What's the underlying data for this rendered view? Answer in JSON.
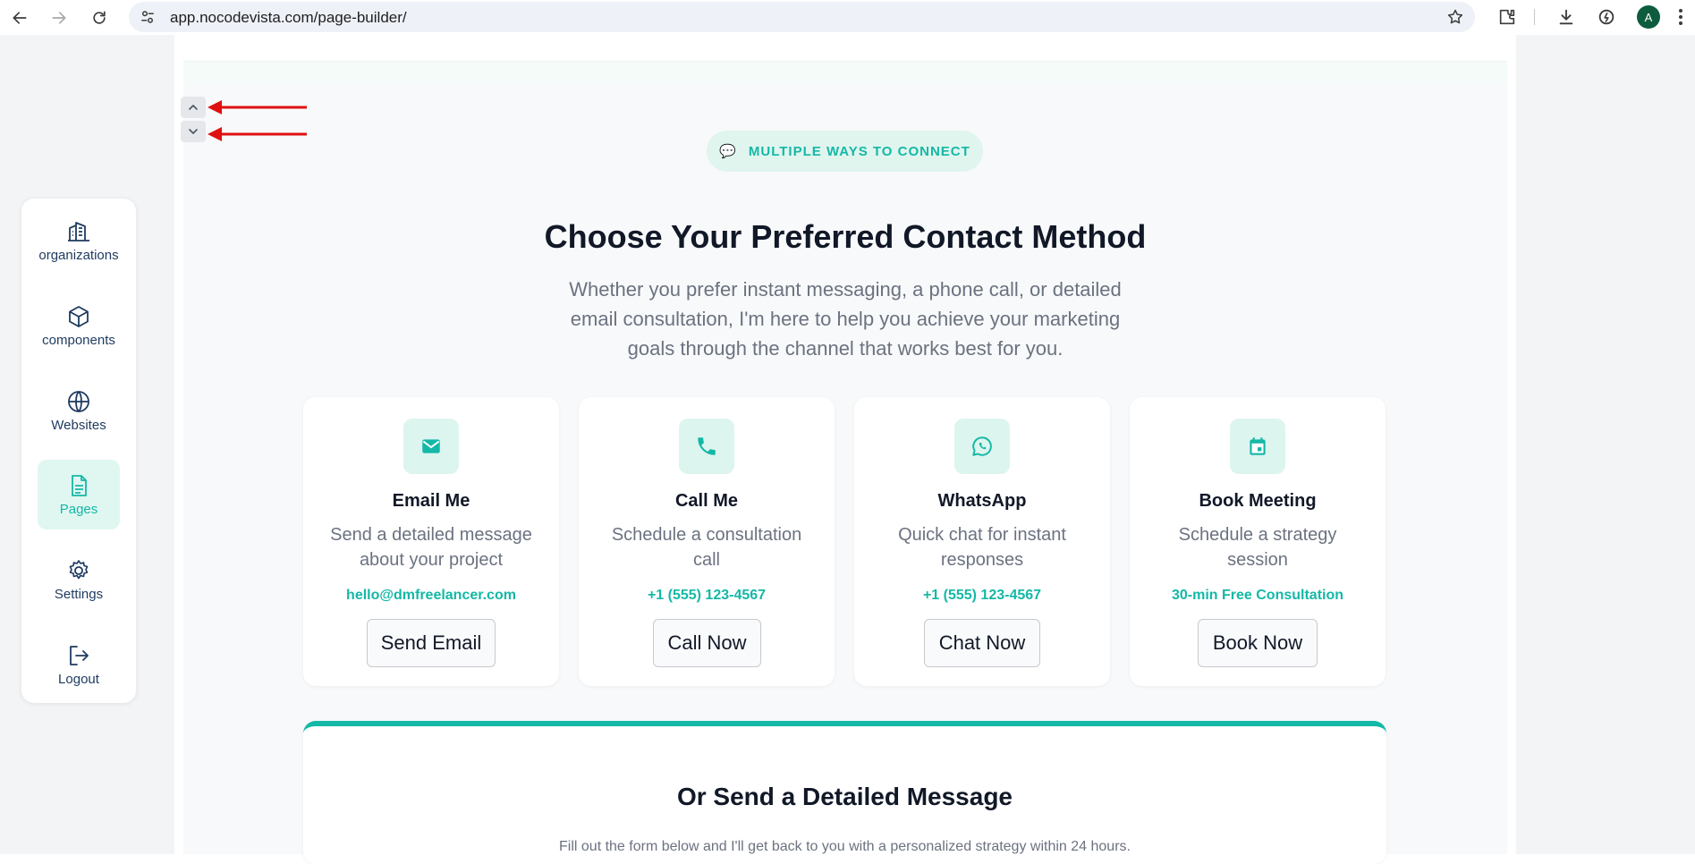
{
  "browser": {
    "url": "app.nocodevista.com/page-builder/",
    "avatar_letter": "A"
  },
  "sidebar": {
    "items": [
      {
        "label": "organizations",
        "icon": "building-icon"
      },
      {
        "label": "components",
        "icon": "cube-icon"
      },
      {
        "label": "Websites",
        "icon": "globe-icon"
      },
      {
        "label": "Pages",
        "icon": "file-icon",
        "active": true
      },
      {
        "label": "Settings",
        "icon": "gear-icon"
      },
      {
        "label": "Logout",
        "icon": "logout-icon"
      }
    ]
  },
  "section": {
    "badge": "MULTIPLE WAYS TO CONNECT",
    "badge_icon": "💬",
    "title": "Choose Your Preferred Contact Method",
    "subtitle": "Whether you prefer instant messaging, a phone call, or detailed email consultation, I'm here to help you achieve your marketing goals through the channel that works best for you."
  },
  "cards": [
    {
      "title": "Email Me",
      "desc": "Send a detailed message about your project",
      "contact": "hello@dmfreelancer.com",
      "button": "Send Email",
      "icon": "mail-icon"
    },
    {
      "title": "Call Me",
      "desc": "Schedule a consultation call",
      "contact": "+1 (555) 123-4567",
      "button": "Call Now",
      "icon": "phone-icon"
    },
    {
      "title": "WhatsApp",
      "desc": "Quick chat for instant responses",
      "contact": "+1 (555) 123-4567",
      "button": "Chat Now",
      "icon": "whatsapp-icon"
    },
    {
      "title": "Book Meeting",
      "desc": "Schedule a strategy session",
      "contact": "30-min Free Consultation",
      "button": "Book Now",
      "icon": "calendar-icon"
    }
  ],
  "form": {
    "title": "Or Send a Detailed Message",
    "subtitle": "Fill out the form below and I'll get back to you with a personalized strategy within 24 hours."
  },
  "colors": {
    "accent": "#14b8a6",
    "accent_light": "#ddf5ef",
    "annotation_arrow": "#e01010"
  }
}
